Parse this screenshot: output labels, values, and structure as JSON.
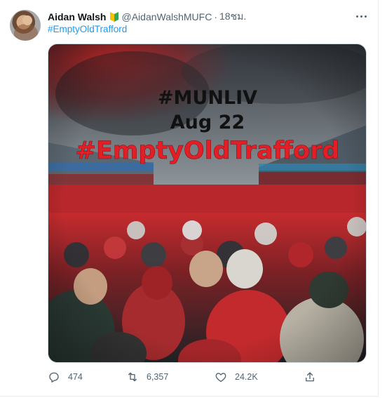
{
  "tweet": {
    "author_name": "Aidan Walsh",
    "verified_badge_icon": "beginner-badge-icon",
    "handle": "@AidanWalshMUFC",
    "separator": "·",
    "time": "18ชม.",
    "text_hashtag": "#EmptyOldTrafford",
    "image_text": {
      "line1": "#MUNLIV",
      "line2": "Aug 22",
      "line3": "#EmptyOldTrafford"
    }
  },
  "actions": {
    "reply_count": "474",
    "retweet_count": "6,357",
    "like_count": "24.2K"
  },
  "colors": {
    "link": "#1d9bf0",
    "muted": "#536471",
    "hashtag_red": "#e21f26",
    "crowd_red": "#b3121b"
  }
}
